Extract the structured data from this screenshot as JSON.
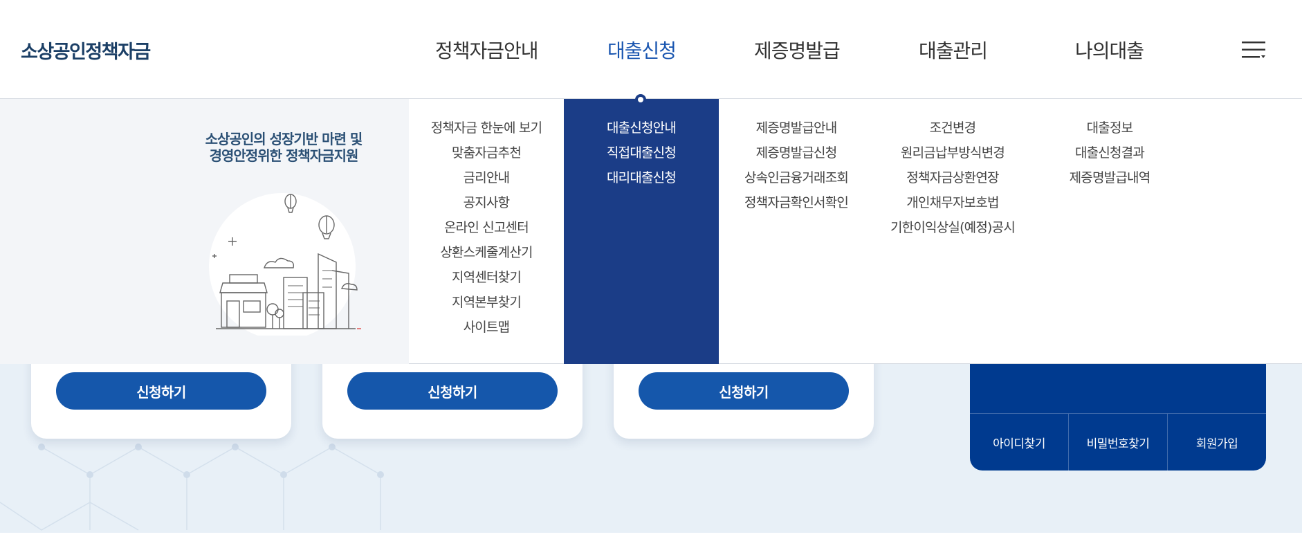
{
  "logo": "소상공인정책자금",
  "nav": [
    {
      "label": "정책자금안내"
    },
    {
      "label": "대출신청"
    },
    {
      "label": "제증명발급"
    },
    {
      "label": "대출관리"
    },
    {
      "label": "나의대출"
    }
  ],
  "active_nav_index": 1,
  "promo": {
    "line1": "소상공인의 성장기반 마련 및",
    "line2": "경영안정위한 정책자금지원"
  },
  "submenu": [
    {
      "items": [
        "정책자금 한눈에 보기",
        "맞춤자금추천",
        "금리안내",
        "공지사항",
        "온라인 신고센터",
        "상환스케줄계산기",
        "지역센터찾기",
        "지역본부찾기",
        "사이트맵"
      ]
    },
    {
      "items": [
        "대출신청안내",
        "직접대출신청",
        "대리대출신청"
      ]
    },
    {
      "items": [
        "제증명발급안내",
        "제증명발급신청",
        "상속인금융거래조회",
        "정책자금확인서확인"
      ]
    },
    {
      "items": [
        "조건변경",
        "원리금납부방식변경",
        "정책자금상환연장",
        "개인채무자보호법",
        "기한이익상실(예정)공시"
      ]
    },
    {
      "items": [
        "대출정보",
        "대출신청결과",
        "제증명발급내역"
      ]
    }
  ],
  "cards": [
    {
      "button": "신청하기"
    },
    {
      "button": "신청하기"
    },
    {
      "button": "신청하기"
    }
  ],
  "login_links": [
    "아이디찾기",
    "비밀번호찾기",
    "회원가입"
  ],
  "colors": {
    "brand_dark": "#1b3d87",
    "accent_blue": "#1a56b0",
    "button_blue": "#1557ab",
    "login_panel": "#003a8f"
  }
}
